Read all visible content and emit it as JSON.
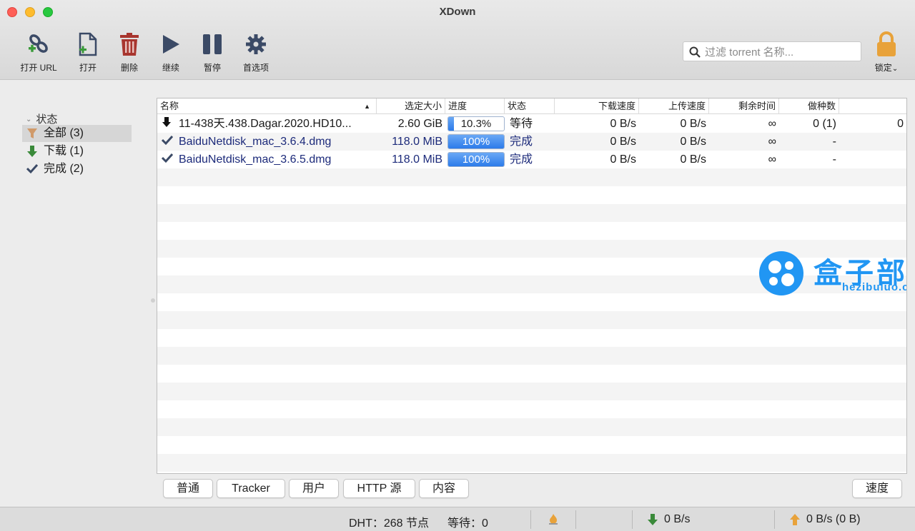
{
  "window": {
    "title": "XDown"
  },
  "toolbar": {
    "open_url": "打开 URL",
    "open": "打开",
    "delete": "删除",
    "resume": "继续",
    "pause": "暂停",
    "preferences": "首选项",
    "lock": "锁定"
  },
  "search": {
    "placeholder": "过滤 torrent 名称..."
  },
  "sidebar": {
    "header": "状态",
    "items": [
      {
        "label": "全部 (3)",
        "icon": "filter-icon"
      },
      {
        "label": "下载 (1)",
        "icon": "download-arrow-icon"
      },
      {
        "label": "完成 (2)",
        "icon": "check-icon"
      }
    ]
  },
  "table": {
    "columns": [
      "名称",
      "选定大小",
      "进度",
      "状态",
      "下载速度",
      "上传速度",
      "剩余时间",
      "做种数"
    ],
    "rows": [
      {
        "name": "11-438天.438.Dagar.2020.HD10...",
        "size": "2.60 GiB",
        "progress": 10.3,
        "progress_label": "10.3%",
        "status": "等待",
        "down": "0 B/s",
        "up": "0 B/s",
        "eta": "∞",
        "seeds": "0 (1)",
        "extra": "0"
      },
      {
        "name": "BaiduNetdisk_mac_3.6.4.dmg",
        "size": "118.0 MiB",
        "progress": 100,
        "progress_label": "100%",
        "status": "完成",
        "down": "0 B/s",
        "up": "0 B/s",
        "eta": "∞",
        "seeds": "-",
        "extra": ""
      },
      {
        "name": "BaiduNetdisk_mac_3.6.5.dmg",
        "size": "118.0 MiB",
        "progress": 100,
        "progress_label": "100%",
        "status": "完成",
        "down": "0 B/s",
        "up": "0 B/s",
        "eta": "∞",
        "seeds": "-",
        "extra": ""
      }
    ]
  },
  "watermark": {
    "title": "盒子部落",
    "url": "hezibuluo.com"
  },
  "tabs": {
    "general": "普通",
    "tracker": "Tracker",
    "peers": "用户",
    "http": "HTTP 源",
    "content": "内容",
    "speed": "速度"
  },
  "statusbar": {
    "dht": "DHT：268 节点",
    "waiting": "等待：0",
    "down_speed": "0 B/s",
    "up_speed": "0 B/s (0 B)"
  },
  "colors": {
    "accent": "#2c7bea",
    "done_text": "#1c2a7a",
    "watermark": "#2196f3",
    "icon_dark": "#3b4a66"
  }
}
